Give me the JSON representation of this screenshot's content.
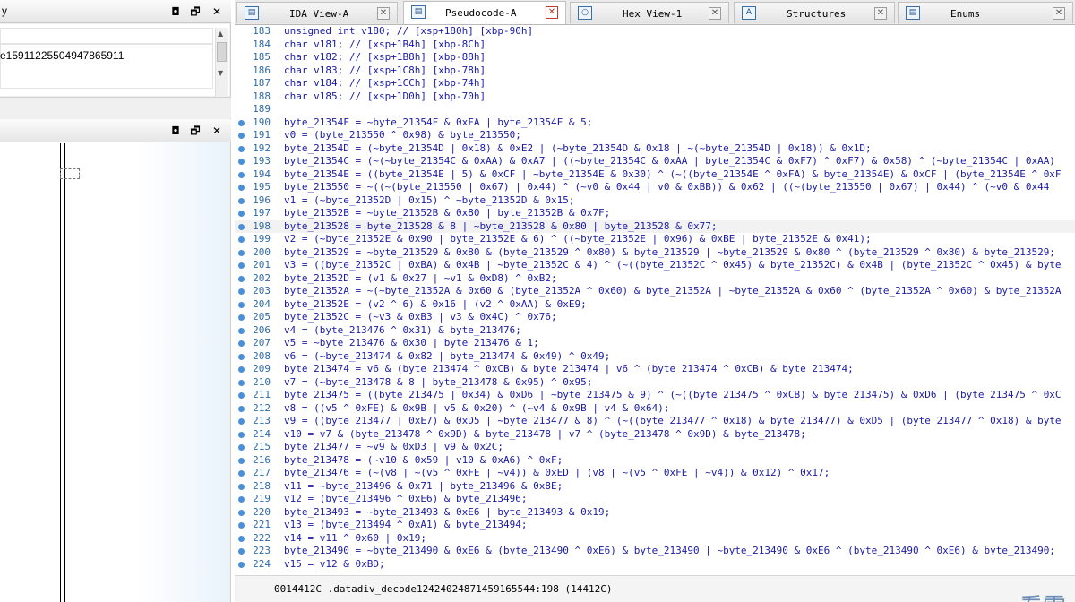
{
  "left": {
    "pane1": {
      "title": "y",
      "value": "e15911225504947865911"
    },
    "pane2": {
      "title": ""
    },
    "controls": {
      "restore": "◘",
      "maximize": "🗗",
      "close": "✕"
    }
  },
  "tabs": [
    {
      "label": "IDA View-A",
      "icon": "▤",
      "icon_name": "ida-view-icon"
    },
    {
      "label": "Pseudocode-A",
      "icon": "▤",
      "icon_name": "pseudocode-icon"
    },
    {
      "label": "Hex View-1",
      "icon": "○",
      "icon_name": "hex-view-icon"
    },
    {
      "label": "Structures",
      "icon": "A",
      "icon_name": "structures-icon"
    },
    {
      "label": "Enums",
      "icon": "▤",
      "icon_name": "enums-icon"
    }
  ],
  "tab_close": "✕",
  "code": {
    "lines": [
      {
        "n": "183",
        "text": "unsigned int v180; // [xsp+180h] [xbp-90h]"
      },
      {
        "n": "184",
        "text": "char v181; // [xsp+1B4h] [xbp-8Ch]"
      },
      {
        "n": "185",
        "text": "char v182; // [xsp+1B8h] [xbp-88h]"
      },
      {
        "n": "186",
        "text": "char v183; // [xsp+1C8h] [xbp-78h]"
      },
      {
        "n": "187",
        "text": "char v184; // [xsp+1CCh] [xbp-74h]"
      },
      {
        "n": "188",
        "text": "char v185; // [xsp+1D0h] [xbp-70h]"
      },
      {
        "n": "189",
        "text": ""
      },
      {
        "n": "190",
        "text": "byte_21354F = ~byte_21354F & 0xFA | byte_21354F & 5;"
      },
      {
        "n": "191",
        "text": "v0 = (byte_213550 ^ 0x98) & byte_213550;"
      },
      {
        "n": "192",
        "text": "byte_21354D = (~byte_21354D | 0x18) & 0xE2 | (~byte_21354D & 0x18 | ~(~byte_21354D | 0x18)) & 0x1D;"
      },
      {
        "n": "193",
        "text": "byte_21354C = (~(~byte_21354C & 0xAA) & 0xA7 | ((~byte_21354C & 0xAA | byte_21354C & 0xF7) ^ 0xF7) & 0x58) ^ (~byte_21354C | 0xAA)"
      },
      {
        "n": "194",
        "text": "byte_21354E = ((byte_21354E | 5) & 0xCF | ~byte_21354E & 0x30) ^ (~((byte_21354E ^ 0xFA) & byte_21354E) & 0xCF | (byte_21354E ^ 0xF"
      },
      {
        "n": "195",
        "text": "byte_213550 = ~((~(byte_213550 | 0x67) | 0x44) ^ (~v0 & 0x44 | v0 & 0xBB)) & 0x62 | ((~(byte_213550 | 0x67) | 0x44) ^ (~v0 & 0x44"
      },
      {
        "n": "196",
        "text": "v1 = (~byte_21352D | 0x15) ^ ~byte_21352D & 0x15;"
      },
      {
        "n": "197",
        "text": "byte_21352B = ~byte_21352B & 0x80 | byte_21352B & 0x7F;"
      },
      {
        "n": "198",
        "text": "byte_213528 = byte_213528 & 8 | ~byte_213528 & 0x80 | byte_213528 & 0x77;"
      },
      {
        "n": "199",
        "text": "v2 = (~byte_21352E & 0x90 | byte_21352E & 6) ^ ((~byte_21352E | 0x96) & 0xBE | byte_21352E & 0x41);"
      },
      {
        "n": "200",
        "text": "byte_213529 = ~byte_213529 & 0x80 & (byte_213529 ^ 0x80) & byte_213529 | ~byte_213529 & 0x80 ^ (byte_213529 ^ 0x80) & byte_213529;"
      },
      {
        "n": "201",
        "text": "v3 = ((byte_21352C | 0xBA) & 0x4B | ~byte_21352C & 4) ^ (~((byte_21352C ^ 0x45) & byte_21352C) & 0x4B | (byte_21352C ^ 0x45) & byte"
      },
      {
        "n": "202",
        "text": "byte_21352D = (v1 & 0x27 | ~v1 & 0xD8) ^ 0xB2;"
      },
      {
        "n": "203",
        "text": "byte_21352A = ~(~byte_21352A & 0x60 & (byte_21352A ^ 0x60) & byte_21352A | ~byte_21352A & 0x60 ^ (byte_21352A ^ 0x60) & byte_21352A"
      },
      {
        "n": "204",
        "text": "byte_21352E = (v2 ^ 6) & 0x16 | (v2 ^ 0xAA) & 0xE9;"
      },
      {
        "n": "205",
        "text": "byte_21352C = (~v3 & 0xB3 | v3 & 0x4C) ^ 0x76;"
      },
      {
        "n": "206",
        "text": "v4 = (byte_213476 ^ 0x31) & byte_213476;"
      },
      {
        "n": "207",
        "text": "v5 = ~byte_213476 & 0x30 | byte_213476 & 1;"
      },
      {
        "n": "208",
        "text": "v6 = (~byte_213474 & 0x82 | byte_213474 & 0x49) ^ 0x49;"
      },
      {
        "n": "209",
        "text": "byte_213474 = v6 & (byte_213474 ^ 0xCB) & byte_213474 | v6 ^ (byte_213474 ^ 0xCB) & byte_213474;"
      },
      {
        "n": "210",
        "text": "v7 = (~byte_213478 & 8 | byte_213478 & 0x95) ^ 0x95;"
      },
      {
        "n": "211",
        "text": "byte_213475 = ((byte_213475 | 0x34) & 0xD6 | ~byte_213475 & 9) ^ (~((byte_213475 ^ 0xCB) & byte_213475) & 0xD6 | (byte_213475 ^ 0xC"
      },
      {
        "n": "212",
        "text": "v8 = ((v5 ^ 0xFE) & 0x9B | v5 & 0x20) ^ (~v4 & 0x9B | v4 & 0x64);"
      },
      {
        "n": "213",
        "text": "v9 = ((byte_213477 | 0xE7) & 0xD5 | ~byte_213477 & 8) ^ (~((byte_213477 ^ 0x18) & byte_213477) & 0xD5 | (byte_213477 ^ 0x18) & byte"
      },
      {
        "n": "214",
        "text": "v10 = v7 & (byte_213478 ^ 0x9D) & byte_213478 | v7 ^ (byte_213478 ^ 0x9D) & byte_213478;"
      },
      {
        "n": "215",
        "text": "byte_213477 = ~v9 & 0xD3 | v9 & 0x2C;"
      },
      {
        "n": "216",
        "text": "byte_213478 = (~v10 & 0x59 | v10 & 0xA6) ^ 0xF;"
      },
      {
        "n": "217",
        "text": "byte_213476 = (~(v8 | ~(v5 ^ 0xFE | ~v4)) & 0xED | (v8 | ~(v5 ^ 0xFE | ~v4)) & 0x12) ^ 0x17;"
      },
      {
        "n": "218",
        "text": "v11 = ~byte_213496 & 0x71 | byte_213496 & 0x8E;"
      },
      {
        "n": "219",
        "text": "v12 = (byte_213496 ^ 0xE6) & byte_213496;"
      },
      {
        "n": "220",
        "text": "byte_213493 = ~byte_213493 & 0xE6 | byte_213493 & 0x19;"
      },
      {
        "n": "221",
        "text": "v13 = (byte_213494 ^ 0xA1) & byte_213494;"
      },
      {
        "n": "222",
        "text": "v14 = v11 ^ 0x60 | 0x19;"
      },
      {
        "n": "223",
        "text": "byte_213490 = ~byte_213490 & 0xE6 & (byte_213490 ^ 0xE6) & byte_213490 | ~byte_213490 & 0xE6 ^ (byte_213490 ^ 0xE6) & byte_213490;"
      },
      {
        "n": "224",
        "text": "v15 = v12 & 0xBD;"
      }
    ]
  },
  "status": {
    "text": "0014412C .datadiv_decode12424024871459165544:198 (14412C)"
  },
  "watermark": {
    "text": "看雪"
  }
}
